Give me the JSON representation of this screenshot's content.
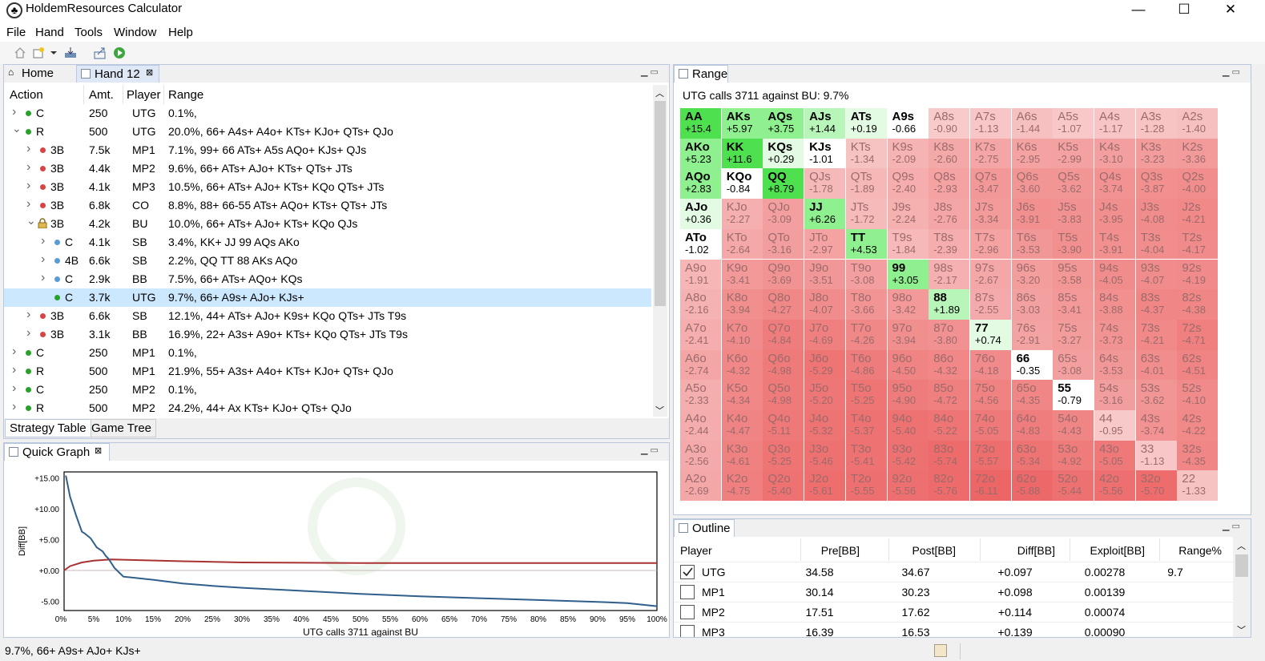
{
  "app": {
    "title": "HoldemResources Calculator",
    "window_buttons": [
      "—",
      "☐",
      "✕"
    ]
  },
  "menu": [
    "File",
    "Hand",
    "Tools",
    "Window",
    "Help"
  ],
  "left_tabs": {
    "home": "Home",
    "hand": "Hand 12"
  },
  "strategy": {
    "headers": [
      "Action",
      "Amt.",
      "Player",
      "Range"
    ],
    "rows": [
      {
        "indent": 0,
        "chev": ">",
        "dot": "g",
        "act": "C",
        "amt": "250",
        "player": "UTG",
        "range": "0.1%,"
      },
      {
        "indent": 0,
        "chev": "v",
        "dot": "g",
        "act": "R",
        "amt": "500",
        "player": "UTG",
        "range": "20.0%, 66+ A4s+ A4o+ KTs+ KJo+ QTs+ QJo"
      },
      {
        "indent": 1,
        "chev": ">",
        "dot": "r",
        "act": "3B",
        "amt": "7.5k",
        "player": "MP1",
        "range": "7.1%, 99+ 66 ATs+ A5s AQo+ KJs+ QJs"
      },
      {
        "indent": 1,
        "chev": ">",
        "dot": "r",
        "act": "3B",
        "amt": "4.4k",
        "player": "MP2",
        "range": "9.6%, 66+ ATs+ AJo+ KTs+ QTs+ JTs"
      },
      {
        "indent": 1,
        "chev": ">",
        "dot": "r",
        "act": "3B",
        "amt": "4.1k",
        "player": "MP3",
        "range": "10.5%, 66+ ATs+ AJo+ KTs+ KQo QTs+ JTs"
      },
      {
        "indent": 1,
        "chev": ">",
        "dot": "r",
        "act": "3B",
        "amt": "6.8k",
        "player": "CO",
        "range": "8.8%, 88+ 66-55 ATs+ AQo+ KTs+ QTs+ JTs"
      },
      {
        "indent": 1,
        "chev": "v",
        "dot": "lock",
        "act": "3B",
        "amt": "4.2k",
        "player": "BU",
        "range": "10.0%, 66+ ATs+ AJo+ KTs+ KQo QJs"
      },
      {
        "indent": 2,
        "chev": ">",
        "dot": "b",
        "act": "C",
        "amt": "4.1k",
        "player": "SB",
        "range": "3.4%, KK+ JJ 99 AQs AKo"
      },
      {
        "indent": 2,
        "chev": ">",
        "dot": "b",
        "act": "4B",
        "amt": "6.6k",
        "player": "SB",
        "range": "2.2%, QQ TT 88 AKs AQo"
      },
      {
        "indent": 2,
        "chev": ">",
        "dot": "b",
        "act": "C",
        "amt": "2.9k",
        "player": "BB",
        "range": "7.5%, 66+ ATs+ AQo+ KQs"
      },
      {
        "indent": 2,
        "chev": "",
        "dot": "g",
        "act": "C",
        "amt": "3.7k",
        "player": "UTG",
        "range": "9.7%, 66+ A9s+ AJo+ KJs+",
        "selected": true
      },
      {
        "indent": 1,
        "chev": ">",
        "dot": "r",
        "act": "3B",
        "amt": "6.6k",
        "player": "SB",
        "range": "12.1%, 44+ ATs+ AJo+ K9s+ KQo QTs+ JTs T9s"
      },
      {
        "indent": 1,
        "chev": ">",
        "dot": "r",
        "act": "3B",
        "amt": "3.1k",
        "player": "BB",
        "range": "16.9%, 22+ A3s+ A9o+ KTs+ KQo QTs+ JTs T9s"
      },
      {
        "indent": 0,
        "chev": ">",
        "dot": "g",
        "act": "C",
        "amt": "250",
        "player": "MP1",
        "range": "0.1%,"
      },
      {
        "indent": 0,
        "chev": ">",
        "dot": "g",
        "act": "R",
        "amt": "500",
        "player": "MP1",
        "range": "21.9%, 55+ A3s+ A4o+ KTs+ KJo+ QTs+ QJo"
      },
      {
        "indent": 0,
        "chev": ">",
        "dot": "g",
        "act": "C",
        "amt": "250",
        "player": "MP2",
        "range": "0.1%,"
      },
      {
        "indent": 0,
        "chev": ">",
        "dot": "g",
        "act": "R",
        "amt": "500",
        "player": "MP2",
        "range": "24.2%, 44+ Ax KTs+ KJo+ QTs+ QJo"
      }
    ],
    "bottom_tabs": [
      "Strategy Table",
      "Game Tree"
    ]
  },
  "quick_graph": {
    "tab": "Quick Graph",
    "chart_data": {
      "type": "line",
      "title": "",
      "xlabel": "UTG calls 3711 against BU",
      "ylabel": "Diff[BB]",
      "xlim": [
        0,
        100
      ],
      "ylim": [
        -6.5,
        16
      ],
      "yticks": [
        "+15.00",
        "+10.00",
        "+5.00",
        "+0.00",
        "-5.00"
      ],
      "ytick_values": [
        15,
        10,
        5,
        0,
        -5
      ],
      "xticks": [
        "0%",
        "5%",
        "10%",
        "15%",
        "20%",
        "25%",
        "30%",
        "35%",
        "40%",
        "45%",
        "50%",
        "55%",
        "60%",
        "65%",
        "70%",
        "75%",
        "80%",
        "85%",
        "90%",
        "95%",
        "100%"
      ],
      "series": [
        {
          "color": "#2f5f8a",
          "x": [
            0.3,
            1,
            2,
            3,
            3.5,
            4.5,
            5.5,
            6.5,
            7,
            7.5,
            8.5,
            10,
            12,
            15,
            20,
            25,
            30,
            40,
            50,
            60,
            70,
            80,
            90,
            95,
            100
          ],
          "y": [
            15.4,
            12,
            9,
            6.3,
            6,
            5.2,
            3.75,
            3.1,
            2.4,
            1.9,
            0.4,
            -1.0,
            -1.2,
            -1.5,
            -2.1,
            -2.5,
            -2.8,
            -3.3,
            -3.8,
            -4.2,
            -4.5,
            -4.8,
            -5.1,
            -5.3,
            -5.8
          ]
        },
        {
          "color": "#a83232",
          "x": [
            0,
            1,
            3,
            5,
            8,
            12,
            20,
            30,
            50,
            70,
            100
          ],
          "y": [
            0,
            0.7,
            1.3,
            1.6,
            1.8,
            1.7,
            1.5,
            1.3,
            1.2,
            1.2,
            1.2
          ]
        }
      ]
    }
  },
  "range_panel": {
    "tab": "Range",
    "summary": "UTG calls 3711 against BU: 9.7%",
    "grid": [
      [
        [
          "AA",
          "+15.4",
          "g3"
        ],
        [
          "AKs",
          "+5.97",
          "g2"
        ],
        [
          "AQs",
          "+3.75",
          "g2"
        ],
        [
          "AJs",
          "+1.44",
          "g1"
        ],
        [
          "ATs",
          "+0.19",
          "g0"
        ],
        [
          "A9s",
          "-0.66",
          "r0"
        ],
        [
          "A8s",
          "-0.90",
          "f"
        ],
        [
          "A7s",
          "-1.13",
          "f"
        ],
        [
          "A6s",
          "-1.44",
          "f"
        ],
        [
          "A5s",
          "-1.07",
          "f"
        ],
        [
          "A4s",
          "-1.17",
          "f"
        ],
        [
          "A3s",
          "-1.28",
          "f"
        ],
        [
          "A2s",
          "-1.40",
          "f"
        ]
      ],
      [
        [
          "AKo",
          "+5.23",
          "g2"
        ],
        [
          "KK",
          "+11.6",
          "g3"
        ],
        [
          "KQs",
          "+0.29",
          "g0"
        ],
        [
          "KJs",
          "-1.01",
          "r0"
        ],
        [
          "KTs",
          "-1.34",
          "f"
        ],
        [
          "K9s",
          "-2.09",
          "f"
        ],
        [
          "K8s",
          "-2.60",
          "f"
        ],
        [
          "K7s",
          "-2.75",
          "f"
        ],
        [
          "K6s",
          "-2.95",
          "f"
        ],
        [
          "K5s",
          "-2.99",
          "f"
        ],
        [
          "K4s",
          "-3.10",
          "f"
        ],
        [
          "K3s",
          "-3.23",
          "f"
        ],
        [
          "K2s",
          "-3.36",
          "f"
        ]
      ],
      [
        [
          "AQo",
          "+2.83",
          "g2"
        ],
        [
          "KQo",
          "-0.84",
          "r0"
        ],
        [
          "QQ",
          "+8.79",
          "g3"
        ],
        [
          "QJs",
          "-1.78",
          "f"
        ],
        [
          "QTs",
          "-1.89",
          "f"
        ],
        [
          "Q9s",
          "-2.40",
          "f"
        ],
        [
          "Q8s",
          "-2.93",
          "f"
        ],
        [
          "Q7s",
          "-3.47",
          "f"
        ],
        [
          "Q6s",
          "-3.60",
          "f"
        ],
        [
          "Q5s",
          "-3.62",
          "f"
        ],
        [
          "Q4s",
          "-3.74",
          "f"
        ],
        [
          "Q3s",
          "-3.87",
          "f"
        ],
        [
          "Q2s",
          "-4.00",
          "f"
        ]
      ],
      [
        [
          "AJo",
          "+0.36",
          "g0"
        ],
        [
          "KJo",
          "-2.27",
          "f"
        ],
        [
          "QJo",
          "-3.09",
          "f"
        ],
        [
          "JJ",
          "+6.26",
          "g2"
        ],
        [
          "JTs",
          "-1.72",
          "f"
        ],
        [
          "J9s",
          "-2.24",
          "f"
        ],
        [
          "J8s",
          "-2.76",
          "f"
        ],
        [
          "J7s",
          "-3.34",
          "f"
        ],
        [
          "J6s",
          "-3.91",
          "f"
        ],
        [
          "J5s",
          "-3.83",
          "f"
        ],
        [
          "J4s",
          "-3.95",
          "f"
        ],
        [
          "J3s",
          "-4.08",
          "f"
        ],
        [
          "J2s",
          "-4.21",
          "f"
        ]
      ],
      [
        [
          "ATo",
          "-1.02",
          "r0"
        ],
        [
          "KTo",
          "-2.64",
          "f"
        ],
        [
          "QTo",
          "-3.16",
          "f"
        ],
        [
          "JTo",
          "-2.97",
          "f"
        ],
        [
          "TT",
          "+4.53",
          "g2"
        ],
        [
          "T9s",
          "-1.84",
          "f"
        ],
        [
          "T8s",
          "-2.39",
          "f"
        ],
        [
          "T7s",
          "-2.96",
          "f"
        ],
        [
          "T6s",
          "-3.53",
          "f"
        ],
        [
          "T5s",
          "-3.90",
          "f"
        ],
        [
          "T4s",
          "-3.91",
          "f"
        ],
        [
          "T3s",
          "-4.04",
          "f"
        ],
        [
          "T2s",
          "-4.17",
          "f"
        ]
      ],
      [
        [
          "A9o",
          "-1.91",
          "f"
        ],
        [
          "K9o",
          "-3.41",
          "f"
        ],
        [
          "Q9o",
          "-3.69",
          "f"
        ],
        [
          "J9o",
          "-3.51",
          "f"
        ],
        [
          "T9o",
          "-3.08",
          "f"
        ],
        [
          "99",
          "+3.05",
          "g2"
        ],
        [
          "98s",
          "-2.17",
          "f"
        ],
        [
          "97s",
          "-2.67",
          "f"
        ],
        [
          "96s",
          "-3.20",
          "f"
        ],
        [
          "95s",
          "-3.58",
          "f"
        ],
        [
          "94s",
          "-4.05",
          "f"
        ],
        [
          "93s",
          "-4.07",
          "f"
        ],
        [
          "92s",
          "-4.19",
          "f"
        ]
      ],
      [
        [
          "A8o",
          "-2.16",
          "f"
        ],
        [
          "K8o",
          "-3.94",
          "f"
        ],
        [
          "Q8o",
          "-4.27",
          "f"
        ],
        [
          "J8o",
          "-4.07",
          "f"
        ],
        [
          "T8o",
          "-3.66",
          "f"
        ],
        [
          "98o",
          "-3.42",
          "f"
        ],
        [
          "88",
          "+1.89",
          "g1"
        ],
        [
          "87s",
          "-2.55",
          "f"
        ],
        [
          "86s",
          "-3.03",
          "f"
        ],
        [
          "85s",
          "-3.41",
          "f"
        ],
        [
          "84s",
          "-3.88",
          "f"
        ],
        [
          "83s",
          "-4.37",
          "f"
        ],
        [
          "82s",
          "-4.38",
          "f"
        ]
      ],
      [
        [
          "A7o",
          "-2.41",
          "f"
        ],
        [
          "K7o",
          "-4.10",
          "f"
        ],
        [
          "Q7o",
          "-4.84",
          "f"
        ],
        [
          "J7o",
          "-4.69",
          "f"
        ],
        [
          "T7o",
          "-4.26",
          "f"
        ],
        [
          "97o",
          "-3.94",
          "f"
        ],
        [
          "87o",
          "-3.80",
          "f"
        ],
        [
          "77",
          "+0.74",
          "g0"
        ],
        [
          "76s",
          "-2.91",
          "f"
        ],
        [
          "75s",
          "-3.27",
          "f"
        ],
        [
          "74s",
          "-3.73",
          "f"
        ],
        [
          "73s",
          "-4.21",
          "f"
        ],
        [
          "72s",
          "-4.71",
          "f"
        ]
      ],
      [
        [
          "A6o",
          "-2.74",
          "f"
        ],
        [
          "K6o",
          "-4.32",
          "f"
        ],
        [
          "Q6o",
          "-4.98",
          "f"
        ],
        [
          "J6o",
          "-5.29",
          "f"
        ],
        [
          "T6o",
          "-4.86",
          "f"
        ],
        [
          "96o",
          "-4.50",
          "f"
        ],
        [
          "86o",
          "-4.32",
          "f"
        ],
        [
          "76o",
          "-4.18",
          "f"
        ],
        [
          "66",
          "-0.35",
          "r0"
        ],
        [
          "65s",
          "-3.08",
          "f"
        ],
        [
          "64s",
          "-3.53",
          "f"
        ],
        [
          "63s",
          "-4.01",
          "f"
        ],
        [
          "62s",
          "-4.51",
          "f"
        ]
      ],
      [
        [
          "A5o",
          "-2.33",
          "f"
        ],
        [
          "K5o",
          "-4.34",
          "f"
        ],
        [
          "Q5o",
          "-4.98",
          "f"
        ],
        [
          "J5o",
          "-5.20",
          "f"
        ],
        [
          "T5o",
          "-5.25",
          "f"
        ],
        [
          "95o",
          "-4.90",
          "f"
        ],
        [
          "85o",
          "-4.72",
          "f"
        ],
        [
          "75o",
          "-4.56",
          "f"
        ],
        [
          "65o",
          "-4.35",
          "f"
        ],
        [
          "55",
          "-0.79",
          "r0"
        ],
        [
          "54s",
          "-3.16",
          "f"
        ],
        [
          "53s",
          "-3.62",
          "f"
        ],
        [
          "52s",
          "-4.10",
          "f"
        ]
      ],
      [
        [
          "A4o",
          "-2.44",
          "f"
        ],
        [
          "K4o",
          "-4.47",
          "f"
        ],
        [
          "Q4o",
          "-5.11",
          "f"
        ],
        [
          "J4o",
          "-5.32",
          "f"
        ],
        [
          "T4o",
          "-5.37",
          "f"
        ],
        [
          "94o",
          "-5.40",
          "f"
        ],
        [
          "84o",
          "-5.22",
          "f"
        ],
        [
          "74o",
          "-5.05",
          "f"
        ],
        [
          "64o",
          "-4.83",
          "f"
        ],
        [
          "54o",
          "-4.43",
          "f"
        ],
        [
          "44",
          "-0.95",
          "f"
        ],
        [
          "43s",
          "-3.74",
          "f"
        ],
        [
          "42s",
          "-4.22",
          "f"
        ]
      ],
      [
        [
          "A3o",
          "-2.56",
          "f"
        ],
        [
          "K3o",
          "-4.61",
          "f"
        ],
        [
          "Q3o",
          "-5.25",
          "f"
        ],
        [
          "J3o",
          "-5.46",
          "f"
        ],
        [
          "T3o",
          "-5.41",
          "f"
        ],
        [
          "93o",
          "-5.42",
          "f"
        ],
        [
          "83o",
          "-5.74",
          "f"
        ],
        [
          "73o",
          "-5.57",
          "f"
        ],
        [
          "63o",
          "-5.34",
          "f"
        ],
        [
          "53o",
          "-4.92",
          "f"
        ],
        [
          "43o",
          "-5.05",
          "f"
        ],
        [
          "33",
          "-1.13",
          "f"
        ],
        [
          "32s",
          "-4.35",
          "f"
        ]
      ],
      [
        [
          "A2o",
          "-2.69",
          "f"
        ],
        [
          "K2o",
          "-4.75",
          "f"
        ],
        [
          "Q2o",
          "-5.40",
          "f"
        ],
        [
          "J2o",
          "-5.61",
          "f"
        ],
        [
          "T2o",
          "-5.55",
          "f"
        ],
        [
          "92o",
          "-5.56",
          "f"
        ],
        [
          "82o",
          "-5.76",
          "f"
        ],
        [
          "72o",
          "-6.11",
          "f"
        ],
        [
          "62o",
          "-5.88",
          "f"
        ],
        [
          "52o",
          "-5.44",
          "f"
        ],
        [
          "42o",
          "-5.56",
          "f"
        ],
        [
          "32o",
          "-5.70",
          "f"
        ],
        [
          "22",
          "-1.33",
          "f"
        ]
      ]
    ]
  },
  "outline": {
    "tab": "Outline",
    "headers": [
      "Player",
      "Pre[BB]",
      "Post[BB]",
      "Diff[BB]",
      "Exploit[BB]",
      "Range%"
    ],
    "rows": [
      {
        "checked": true,
        "player": "UTG",
        "pre": "34.58",
        "post": "34.67",
        "diff": "+0.097",
        "exploit": "0.00278",
        "range": "9.7"
      },
      {
        "checked": false,
        "player": "MP1",
        "pre": "30.14",
        "post": "30.23",
        "diff": "+0.098",
        "exploit": "0.00139",
        "range": ""
      },
      {
        "checked": false,
        "player": "MP2",
        "pre": "17.51",
        "post": "17.62",
        "diff": "+0.114",
        "exploit": "0.00074",
        "range": ""
      },
      {
        "checked": false,
        "player": "MP3",
        "pre": "16.39",
        "post": "16.53",
        "diff": "+0.139",
        "exploit": "0.00090",
        "range": ""
      }
    ]
  },
  "status": {
    "text": "9.7%, 66+ A9s+ AJo+ KJs+"
  }
}
